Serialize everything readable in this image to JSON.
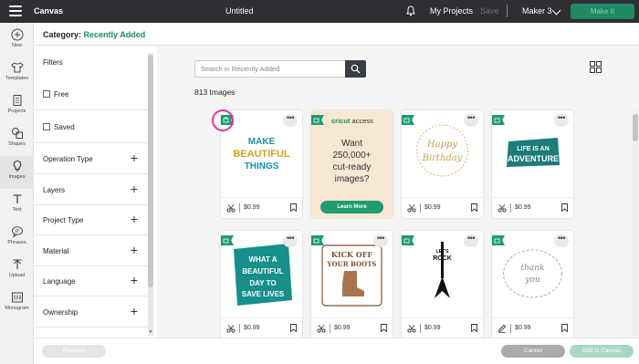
{
  "topbar": {
    "app_name": "Canvas",
    "doc_title": "Untitled",
    "my_projects": "My Projects",
    "save": "Save",
    "machine": "Maker 3",
    "make": "Make It"
  },
  "rail": [
    {
      "label": "New",
      "icon": "plus-circle-icon"
    },
    {
      "label": "Templates",
      "icon": "shirt-icon"
    },
    {
      "label": "Projects",
      "icon": "projects-icon"
    },
    {
      "label": "Shapes",
      "icon": "shapes-icon"
    },
    {
      "label": "Images",
      "icon": "lightbulb-icon"
    },
    {
      "label": "Text",
      "icon": "text-icon"
    },
    {
      "label": "Phrases",
      "icon": "chat-icon"
    },
    {
      "label": "Upload",
      "icon": "upload-icon"
    },
    {
      "label": "Monogram",
      "icon": "monogram-icon"
    }
  ],
  "category": {
    "label": "Category:",
    "value": "Recently Added"
  },
  "filters": {
    "title": "Filters",
    "checkboxes": [
      "Free",
      "Saved"
    ],
    "sections": [
      "Operation Type",
      "Layers",
      "Project Type",
      "Material",
      "Language",
      "Ownership"
    ]
  },
  "search": {
    "placeholder": "Search in Recently Added"
  },
  "image_count": "813 Images",
  "ad": {
    "brand_main": "cricut",
    "brand_sub": "access",
    "line1": "Want",
    "line2": "250,000+",
    "line3": "cut-ready",
    "line4": "images?",
    "button": "Learn More"
  },
  "cards": [
    {
      "title_lines": [
        "MAKE",
        "BEAUTIFUL",
        "THINGS"
      ],
      "price": "$0.99"
    },
    {
      "title_lines": [
        "Happy",
        "Birthday"
      ],
      "price": "$0.99"
    },
    {
      "title_lines": [
        "LIFE IS AN",
        "ADVENTURE"
      ],
      "price": "$0.99"
    },
    {
      "title_lines": [
        "WHAT A",
        "BEAUTIFUL",
        "DAY TO",
        "SAVE LIVES"
      ],
      "price": "$0.99"
    },
    {
      "title_lines": [
        "KICK OFF",
        "YOUR BOOTS"
      ],
      "price": "$0.99"
    },
    {
      "title_lines": [
        "LET'S",
        "ROCK"
      ],
      "price": "$0.99"
    },
    {
      "title_lines": [
        "thank",
        "you"
      ],
      "price": "$0.99"
    }
  ],
  "bottom": {
    "remove": "Remove",
    "cancel": "Cancel",
    "add": "Add to Canvas"
  },
  "colors": {
    "accent": "#1f9b6f",
    "highlight": "#e0379a",
    "topbar": "#2e2e33"
  }
}
